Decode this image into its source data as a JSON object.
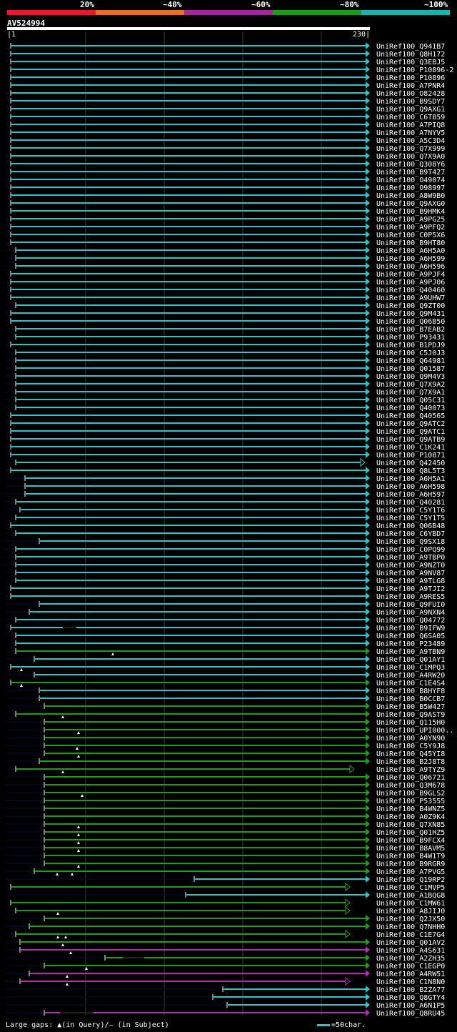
{
  "legend": {
    "labels": [
      "20%",
      "~40%",
      "~60%",
      "~80%",
      "~100%"
    ],
    "colors": [
      "#e8182e",
      "#e8701f",
      "#a0299a",
      "#1e9b1e",
      "#16b6b6"
    ]
  },
  "query": {
    "id": "AV524994",
    "start": "1",
    "end": "230"
  },
  "footer": {
    "gaps_text": "Large gaps: ▲(in Query)/— (in Subject)",
    "scale_text": "=50char."
  },
  "hits": [
    {
      "id": "UniRef100_Q941B7",
      "start": 15,
      "end": 512,
      "color": "cyan",
      "arrow": "full"
    },
    {
      "id": "UniRef100_Q8H172",
      "start": 15,
      "end": 512,
      "color": "cyan",
      "arrow": "full"
    },
    {
      "id": "UniRef100_Q3EBJ5",
      "start": 15,
      "end": 512,
      "color": "cyan",
      "arrow": "full"
    },
    {
      "id": "UniRef100_P10896-2",
      "start": 15,
      "end": 512,
      "color": "cyan",
      "arrow": "full"
    },
    {
      "id": "UniRef100_P10896",
      "start": 15,
      "end": 512,
      "color": "cyan",
      "arrow": "full"
    },
    {
      "id": "UniRef100_A7PNR4",
      "start": 15,
      "end": 512,
      "color": "cyan",
      "arrow": "full"
    },
    {
      "id": "UniRef100_O82428",
      "start": 15,
      "end": 512,
      "color": "cyan",
      "arrow": "full"
    },
    {
      "id": "UniRef100_B9SDY7",
      "start": 15,
      "end": 512,
      "color": "cyan",
      "arrow": "full"
    },
    {
      "id": "UniRef100_Q9AXG1",
      "start": 15,
      "end": 512,
      "color": "cyan",
      "arrow": "full"
    },
    {
      "id": "UniRef100_C6T859",
      "start": 15,
      "end": 512,
      "color": "cyan",
      "arrow": "full"
    },
    {
      "id": "UniRef100_A7PIQ8",
      "start": 15,
      "end": 512,
      "color": "cyan",
      "arrow": "full"
    },
    {
      "id": "UniRef100_A7NYV5",
      "start": 15,
      "end": 512,
      "color": "cyan",
      "arrow": "full"
    },
    {
      "id": "UniRef100_A5C3D4",
      "start": 15,
      "end": 512,
      "color": "cyan",
      "arrow": "full"
    },
    {
      "id": "UniRef100_Q7X999",
      "start": 15,
      "end": 512,
      "color": "cyan",
      "arrow": "full"
    },
    {
      "id": "UniRef100_Q7X9A0",
      "start": 15,
      "end": 512,
      "color": "cyan",
      "arrow": "full"
    },
    {
      "id": "UniRef100_Q308Y6",
      "start": 15,
      "end": 512,
      "color": "cyan",
      "arrow": "full"
    },
    {
      "id": "UniRef100_B9T427",
      "start": 15,
      "end": 512,
      "color": "cyan",
      "arrow": "full"
    },
    {
      "id": "UniRef100_O49074",
      "start": 15,
      "end": 512,
      "color": "cyan",
      "arrow": "full"
    },
    {
      "id": "UniRef100_O98997",
      "start": 15,
      "end": 512,
      "color": "cyan",
      "arrow": "full"
    },
    {
      "id": "UniRef100_A8W9B0",
      "start": 15,
      "end": 512,
      "color": "cyan",
      "arrow": "full"
    },
    {
      "id": "UniRef100_Q9AXG0",
      "start": 15,
      "end": 512,
      "color": "cyan",
      "arrow": "full"
    },
    {
      "id": "UniRef100_B9HMK4",
      "start": 15,
      "end": 512,
      "color": "cyan",
      "arrow": "full"
    },
    {
      "id": "UniRef100_A9PG25",
      "start": 15,
      "end": 512,
      "color": "cyan",
      "arrow": "full"
    },
    {
      "id": "UniRef100_A9PFQ2",
      "start": 15,
      "end": 512,
      "color": "cyan",
      "arrow": "full"
    },
    {
      "id": "UniRef100_C0P5X6",
      "start": 15,
      "end": 512,
      "color": "cyan",
      "arrow": "full"
    },
    {
      "id": "UniRef100_B9HT80",
      "start": 15,
      "end": 512,
      "color": "cyan",
      "arrow": "full"
    },
    {
      "id": "UniRef100_A6H5A0",
      "start": 22,
      "end": 512,
      "color": "cyan",
      "arrow": "full"
    },
    {
      "id": "UniRef100_A6H599",
      "start": 22,
      "end": 512,
      "color": "cyan",
      "arrow": "full"
    },
    {
      "id": "UniRef100_A6H596",
      "start": 22,
      "end": 512,
      "color": "cyan",
      "arrow": "full"
    },
    {
      "id": "UniRef100_A9PJF4",
      "start": 15,
      "end": 512,
      "color": "cyan",
      "arrow": "full"
    },
    {
      "id": "UniRef100_A9PJ06",
      "start": 15,
      "end": 512,
      "color": "cyan",
      "arrow": "full"
    },
    {
      "id": "UniRef100_Q40460",
      "start": 15,
      "end": 512,
      "color": "cyan",
      "arrow": "full"
    },
    {
      "id": "UniRef100_A9UHW7",
      "start": 15,
      "end": 512,
      "color": "cyan",
      "arrow": "full"
    },
    {
      "id": "UniRef100_Q9ZT00",
      "start": 22,
      "end": 512,
      "color": "cyan",
      "arrow": "full"
    },
    {
      "id": "UniRef100_Q9M431",
      "start": 15,
      "end": 512,
      "color": "cyan",
      "arrow": "full"
    },
    {
      "id": "UniRef100_Q06B50",
      "start": 15,
      "end": 512,
      "color": "cyan",
      "arrow": "full"
    },
    {
      "id": "UniRef100_B7EAB2",
      "start": 22,
      "end": 512,
      "color": "cyan",
      "arrow": "full"
    },
    {
      "id": "UniRef100_P93431",
      "start": 22,
      "end": 512,
      "color": "cyan",
      "arrow": "full"
    },
    {
      "id": "UniRef100_B1PDJ9",
      "start": 15,
      "end": 512,
      "color": "cyan",
      "arrow": "full"
    },
    {
      "id": "UniRef100_C5J0J3",
      "start": 22,
      "end": 512,
      "color": "cyan",
      "arrow": "full"
    },
    {
      "id": "UniRef100_Q64981",
      "start": 22,
      "end": 512,
      "color": "cyan",
      "arrow": "full"
    },
    {
      "id": "UniRef100_Q01587",
      "start": 22,
      "end": 512,
      "color": "cyan",
      "arrow": "full"
    },
    {
      "id": "UniRef100_Q9M4V3",
      "start": 22,
      "end": 512,
      "color": "cyan",
      "arrow": "full"
    },
    {
      "id": "UniRef100_Q7X9A2",
      "start": 22,
      "end": 512,
      "color": "cyan",
      "arrow": "full"
    },
    {
      "id": "UniRef100_Q7X9A1",
      "start": 22,
      "end": 512,
      "color": "cyan",
      "arrow": "full"
    },
    {
      "id": "UniRef100_Q05C31",
      "start": 22,
      "end": 512,
      "color": "cyan",
      "arrow": "full"
    },
    {
      "id": "UniRef100_Q40073",
      "start": 22,
      "end": 512,
      "color": "cyan",
      "arrow": "full"
    },
    {
      "id": "UniRef100_Q40565",
      "start": 15,
      "end": 512,
      "color": "cyan",
      "arrow": "full"
    },
    {
      "id": "UniRef100_Q9ATC2",
      "start": 15,
      "end": 512,
      "color": "cyan",
      "arrow": "full"
    },
    {
      "id": "UniRef100_Q9ATC1",
      "start": 15,
      "end": 512,
      "color": "cyan",
      "arrow": "full"
    },
    {
      "id": "UniRef100_Q9ATB9",
      "start": 15,
      "end": 512,
      "color": "cyan",
      "arrow": "full"
    },
    {
      "id": "UniRef100_C1K241",
      "start": 15,
      "end": 512,
      "color": "cyan",
      "arrow": "full"
    },
    {
      "id": "UniRef100_P10871",
      "start": 15,
      "end": 512,
      "color": "cyan",
      "arrow": "full"
    },
    {
      "id": "UniRef100_Q42450",
      "start": 22,
      "end": 505,
      "color": "cyan",
      "arrow": "partial"
    },
    {
      "id": "UniRef100_Q8L5T3",
      "start": 15,
      "end": 512,
      "color": "cyan",
      "arrow": "full"
    },
    {
      "id": "UniRef100_A6H5A1",
      "start": 35,
      "end": 512,
      "color": "cyan",
      "arrow": "full"
    },
    {
      "id": "UniRef100_A6H598",
      "start": 35,
      "end": 512,
      "color": "cyan",
      "arrow": "full"
    },
    {
      "id": "UniRef100_A6H597",
      "start": 35,
      "end": 512,
      "color": "cyan",
      "arrow": "full"
    },
    {
      "id": "UniRef100_Q40281",
      "start": 22,
      "end": 512,
      "color": "cyan",
      "arrow": "full"
    },
    {
      "id": "UniRef100_C5Y1T6",
      "start": 28,
      "end": 512,
      "color": "cyan",
      "arrow": "full"
    },
    {
      "id": "UniRef100_C5Y1T5",
      "start": 22,
      "end": 512,
      "color": "cyan",
      "arrow": "full"
    },
    {
      "id": "UniRef100_Q06B48",
      "start": 15,
      "end": 512,
      "color": "cyan",
      "arrow": "full"
    },
    {
      "id": "UniRef100_C6YBD7",
      "start": 22,
      "end": 512,
      "color": "cyan",
      "arrow": "full"
    },
    {
      "id": "UniRef100_Q9SX18",
      "start": 55,
      "end": 512,
      "color": "cyan",
      "arrow": "full"
    },
    {
      "id": "UniRef100_C0PQ99",
      "start": 22,
      "end": 512,
      "color": "cyan",
      "arrow": "full"
    },
    {
      "id": "UniRef100_A9TBP0",
      "start": 22,
      "end": 512,
      "color": "cyan",
      "arrow": "full"
    },
    {
      "id": "UniRef100_A9NZT0",
      "start": 22,
      "end": 512,
      "color": "cyan",
      "arrow": "full"
    },
    {
      "id": "UniRef100_A9NV87",
      "start": 22,
      "end": 512,
      "color": "cyan",
      "arrow": "full"
    },
    {
      "id": "UniRef100_A9TLG8",
      "start": 22,
      "end": 512,
      "color": "cyan",
      "arrow": "full"
    },
    {
      "id": "UniRef100_A9TJI2",
      "start": 15,
      "end": 512,
      "color": "cyan",
      "arrow": "full"
    },
    {
      "id": "UniRef100_A9RES5",
      "start": 15,
      "end": 512,
      "color": "cyan",
      "arrow": "full"
    },
    {
      "id": "UniRef100_Q9FUI0",
      "start": 55,
      "end": 512,
      "color": "cyan",
      "arrow": "full"
    },
    {
      "id": "UniRef100_A9NXN4",
      "start": 41,
      "end": 512,
      "color": "cyan",
      "arrow": "full"
    },
    {
      "id": "UniRef100_Q04772",
      "start": 22,
      "end": 512,
      "color": "cyan",
      "arrow": "full"
    },
    {
      "id": "UniRef100_B9IFW9",
      "start": 15,
      "end": 512,
      "color": "cyan",
      "arrow": "full",
      "subject_gap": [
        88,
        107
      ]
    },
    {
      "id": "UniRef100_Q6SA05",
      "start": 22,
      "end": 512,
      "color": "cyan",
      "arrow": "full"
    },
    {
      "id": "UniRef100_P23489",
      "start": 22,
      "end": 512,
      "color": "cyan",
      "arrow": "full"
    },
    {
      "id": "UniRef100_A9TBN9",
      "start": 22,
      "end": 512,
      "color": "green",
      "arrow": "full",
      "tick_at": 158
    },
    {
      "id": "UniRef100_Q01AY1",
      "start": 48,
      "end": 512,
      "color": "cyan",
      "arrow": "full"
    },
    {
      "id": "UniRef100_C1MPQ3",
      "start": 15,
      "end": 512,
      "color": "cyan",
      "arrow": "full",
      "tick_at": 30
    },
    {
      "id": "UniRef100_A4RW20",
      "start": 48,
      "end": 512,
      "color": "cyan",
      "arrow": "full"
    },
    {
      "id": "UniRef100_C1E4S4",
      "start": 15,
      "end": 512,
      "color": "green",
      "arrow": "full",
      "tick_at": 30
    },
    {
      "id": "UniRef100_B8HYF8",
      "start": 55,
      "end": 512,
      "color": "cyan",
      "arrow": "full"
    },
    {
      "id": "UniRef100_B0CCB7",
      "start": 55,
      "end": 512,
      "color": "cyan",
      "arrow": "full"
    },
    {
      "id": "UniRef100_B5W427",
      "start": 62,
      "end": 512,
      "color": "green",
      "arrow": "full"
    },
    {
      "id": "UniRef100_Q9AST9",
      "start": 22,
      "end": 512,
      "color": "green",
      "arrow": "full",
      "tick_at": 88
    },
    {
      "id": "UniRef100_Q115H0",
      "start": 62,
      "end": 512,
      "color": "green",
      "arrow": "full"
    },
    {
      "id": "UniRef100_UPI000..",
      "start": 62,
      "end": 512,
      "color": "green",
      "arrow": "full",
      "tick_at": 110
    },
    {
      "id": "UniRef100_A0YN90",
      "start": 62,
      "end": 512,
      "color": "green",
      "arrow": "full"
    },
    {
      "id": "UniRef100_C5Y9J8",
      "start": 62,
      "end": 512,
      "color": "green",
      "arrow": "full",
      "tick_at": 108
    },
    {
      "id": "UniRef100_Q45YI8",
      "start": 62,
      "end": 512,
      "color": "green",
      "arrow": "full",
      "tick_at": 110
    },
    {
      "id": "UniRef100_B2J8T8",
      "start": 55,
      "end": 512,
      "color": "green",
      "arrow": "full"
    },
    {
      "id": "UniRef100_A9TYZ9",
      "start": 22,
      "end": 490,
      "color": "green",
      "arrow": "partial",
      "tick_at": 88
    },
    {
      "id": "UniRef100_Q06721",
      "start": 62,
      "end": 512,
      "color": "green",
      "arrow": "full"
    },
    {
      "id": "UniRef100_Q3M678",
      "start": 62,
      "end": 512,
      "color": "green",
      "arrow": "full"
    },
    {
      "id": "UniRef100_B9GLS2",
      "start": 62,
      "end": 512,
      "color": "green",
      "arrow": "full",
      "tick_at": 115
    },
    {
      "id": "UniRef100_P53555",
      "start": 62,
      "end": 512,
      "color": "green",
      "arrow": "full"
    },
    {
      "id": "UniRef100_B4WNZ5",
      "start": 62,
      "end": 512,
      "color": "green",
      "arrow": "full"
    },
    {
      "id": "UniRef100_A0Z9K4",
      "start": 62,
      "end": 512,
      "color": "green",
      "arrow": "full"
    },
    {
      "id": "UniRef100_Q7XN85",
      "start": 62,
      "end": 512,
      "color": "green",
      "arrow": "full",
      "tick_at": 110
    },
    {
      "id": "UniRef100_Q01HZ5",
      "start": 62,
      "end": 512,
      "color": "green",
      "arrow": "full",
      "tick_at": 110
    },
    {
      "id": "UniRef100_B9FCX4",
      "start": 62,
      "end": 512,
      "color": "green",
      "arrow": "full",
      "tick_at": 110
    },
    {
      "id": "UniRef100_B8AVM5",
      "start": 62,
      "end": 512,
      "color": "green",
      "arrow": "full",
      "tick_at": 110
    },
    {
      "id": "UniRef100_B4W1T9",
      "start": 62,
      "end": 512,
      "color": "green",
      "arrow": "full"
    },
    {
      "id": "UniRef100_B9RGR9",
      "start": 62,
      "end": 512,
      "color": "green",
      "arrow": "full",
      "tick_at": 110
    },
    {
      "id": "UniRef100_A7PVG5",
      "start": 48,
      "end": 512,
      "color": "green",
      "arrow": "full",
      "tick_at": 80,
      "tick2_at": 101
    },
    {
      "id": "UniRef100_Q19RP2",
      "start": 272,
      "end": 512,
      "color": "cyan",
      "arrow": "full"
    },
    {
      "id": "UniRef100_C1MVP5",
      "start": 15,
      "end": 484,
      "color": "green",
      "arrow": "partial"
    },
    {
      "id": "UniRef100_A1BQG8",
      "start": 260,
      "end": 512,
      "color": "cyan",
      "arrow": "full"
    },
    {
      "id": "UniRef100_C1MW61",
      "start": 15,
      "end": 484,
      "color": "green",
      "arrow": "partial"
    },
    {
      "id": "UniRef100_A8JIJ0",
      "start": 22,
      "end": 484,
      "color": "green",
      "arrow": "partial",
      "tick_at": 81
    },
    {
      "id": "UniRef100_Q2JX50",
      "start": 62,
      "end": 512,
      "color": "green",
      "arrow": "full"
    },
    {
      "id": "UniRef100_Q7NHH0",
      "start": 41,
      "end": 512,
      "color": "green",
      "arrow": "full"
    },
    {
      "id": "UniRef100_C1E7G4",
      "start": 22,
      "end": 484,
      "color": "green",
      "arrow": "partial",
      "tick_at": 81,
      "tick2_at": 92
    },
    {
      "id": "UniRef100_Q01AV2",
      "start": 28,
      "end": 512,
      "color": "green",
      "arrow": "full",
      "tick_at": 88
    },
    {
      "id": "UniRef100_A4S631",
      "start": 28,
      "end": 512,
      "color": "magenta",
      "arrow": "full",
      "tick_at": 99
    },
    {
      "id": "UniRef100_A2ZH35",
      "start": 147,
      "end": 512,
      "color": "green",
      "arrow": "full",
      "subject_gap": [
        172,
        202
      ]
    },
    {
      "id": "UniRef100_C1EGP0",
      "start": 62,
      "end": 512,
      "color": "green",
      "arrow": "full",
      "tick_at": 121
    },
    {
      "id": "UniRef100_A4RW51",
      "start": 41,
      "end": 512,
      "color": "magenta",
      "arrow": "full",
      "tick_at": 94
    },
    {
      "id": "UniRef100_C1N8N0",
      "start": 28,
      "end": 484,
      "color": "magenta",
      "arrow": "partial",
      "tick_at": 94
    },
    {
      "id": "UniRef100_B2ZA77",
      "start": 312,
      "end": 512,
      "color": "cyan",
      "arrow": "full"
    },
    {
      "id": "UniRef100_Q8GTY4",
      "start": 298,
      "end": 512,
      "color": "cyan",
      "arrow": "full"
    },
    {
      "id": "UniRef100_A6N1P5",
      "start": 318,
      "end": 512,
      "color": "cyan",
      "arrow": "full"
    },
    {
      "id": "UniRef100_Q8RU45",
      "start": 62,
      "end": 512,
      "color": "magenta",
      "arrow": "full",
      "subject_gap": [
        84,
        130
      ]
    }
  ]
}
